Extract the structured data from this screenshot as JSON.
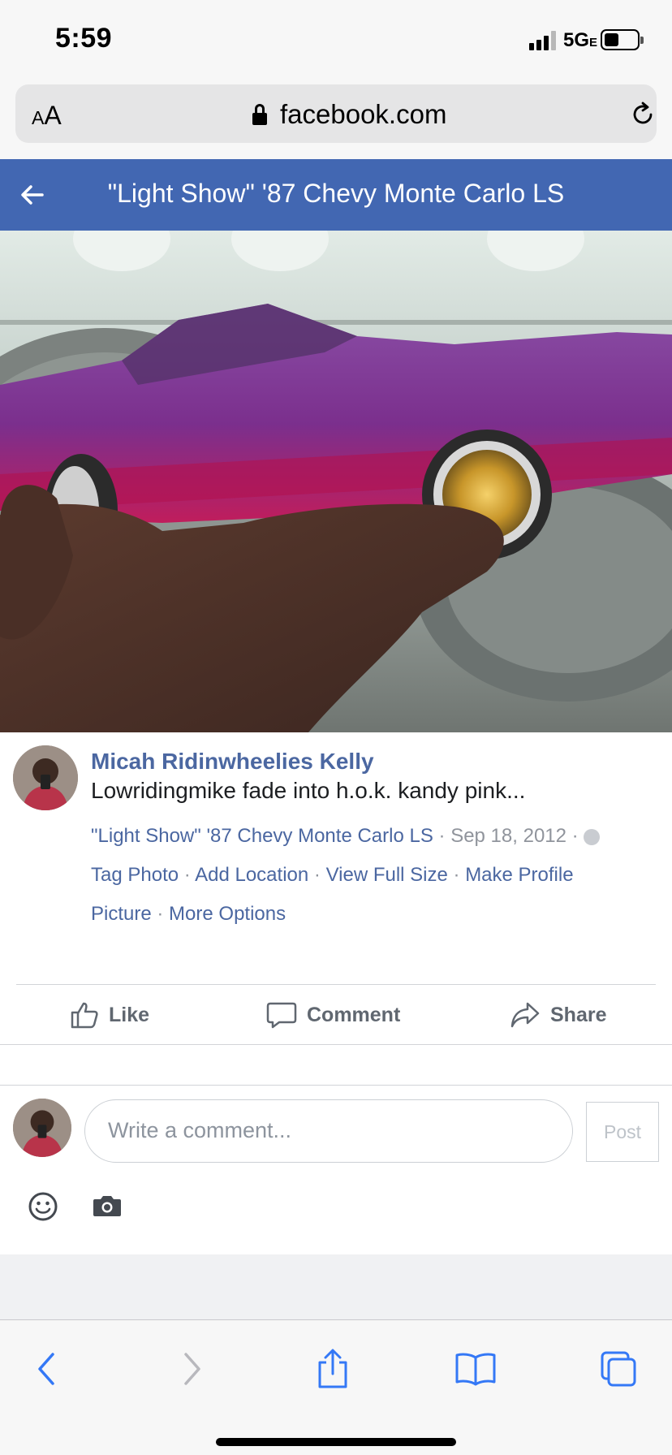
{
  "status_bar": {
    "time": "5:59",
    "network": "5G",
    "network_suffix": "E"
  },
  "browser": {
    "text_size_label_small": "A",
    "text_size_label_large": "A",
    "url": "facebook.com"
  },
  "header": {
    "title": "\"Light Show\" '87 Chevy Monte Carlo LS"
  },
  "post": {
    "author": "Micah Ridinwheelies Kelly",
    "caption": "Lowridingmike fade into h.o.k. kandy pink...",
    "album": "\"Light Show\" '87 Chevy Monte Carlo LS",
    "date": "Sep 18, 2012",
    "separator": "·",
    "links": {
      "tag_photo": "Tag Photo",
      "add_location": "Add Location",
      "view_full_size": "View Full Size",
      "make_profile": "Make Profile",
      "picture": "Picture",
      "more_options": "More Options"
    }
  },
  "actions": {
    "like": "Like",
    "comment": "Comment",
    "share": "Share"
  },
  "composer": {
    "placeholder": "Write a comment...",
    "post_label": "Post"
  },
  "colors": {
    "facebook_blue": "#4267b2",
    "link_blue": "#4b67a1",
    "ios_blue": "#3478f6"
  }
}
